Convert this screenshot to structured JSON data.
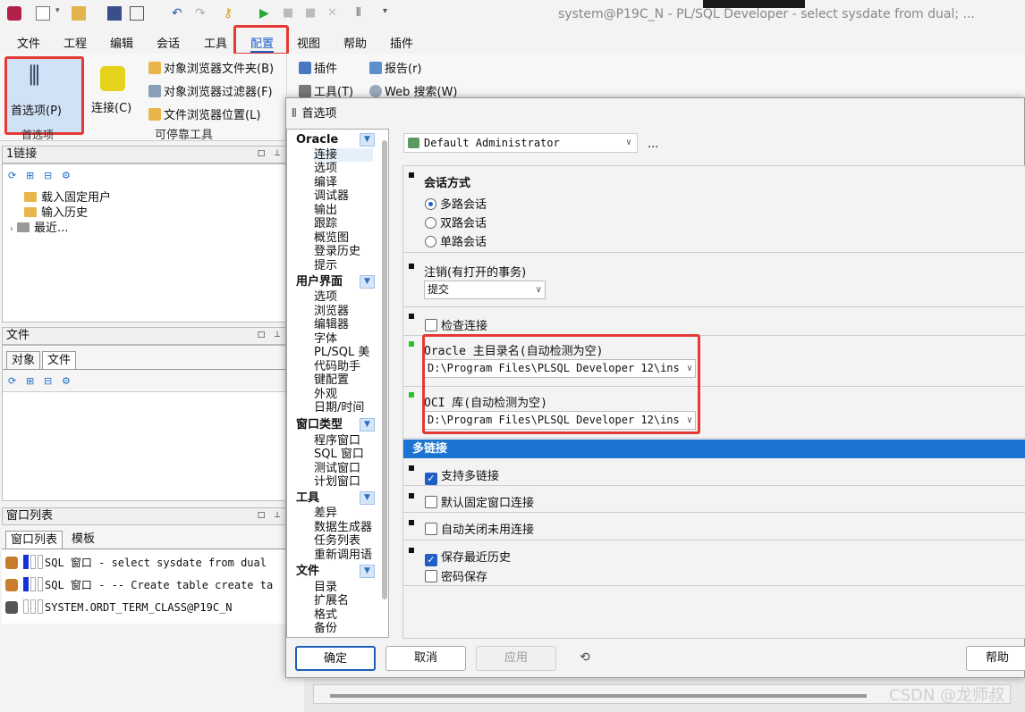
{
  "window": {
    "title": "system@P19C_N - PL/SQL Developer - select sysdate from dual; ..."
  },
  "menu": [
    "文件",
    "工程",
    "编辑",
    "会话",
    "工具",
    "配置",
    "视图",
    "帮助",
    "插件"
  ],
  "ribbon": {
    "preferences_label": "首选项(P)",
    "connect_label": "连接(C)",
    "obj_browser_folder": "对象浏览器文件夹(B)",
    "obj_browser_filter": "对象浏览器过滤器(F)",
    "file_browser_location": "文件浏览器位置(L)",
    "plugins": "插件",
    "tools": "工具(T)",
    "reports": "报告(r)",
    "web_search": "Web 搜索(W)",
    "group_preferences": "首选项",
    "group_dockable": "可停靠工具"
  },
  "connections_panel": {
    "title": "1链接",
    "items": [
      "载入固定用户",
      "输入历史",
      "最近..."
    ]
  },
  "files_panel": {
    "title": "文件",
    "tabs": [
      "对象",
      "文件"
    ]
  },
  "window_list_panel": {
    "title": "窗口列表",
    "tabs": [
      "窗口列表",
      "模板"
    ],
    "rows": [
      "SQL 窗口 - select sysdate from dual",
      "SQL 窗口 - -- Create table create ta",
      "SYSTEM.ORDT_TERM_CLASS@P19C_N"
    ]
  },
  "dialog": {
    "title": "首选项",
    "profile": "Default Administrator",
    "profile_more": "...",
    "nav": {
      "groups": [
        {
          "label": "Oracle",
          "items": [
            "连接",
            "选项",
            "编译",
            "调试器",
            "输出",
            "跟踪",
            "概览图",
            "登录历史",
            "提示"
          ]
        },
        {
          "label": "用户界面",
          "items": [
            "选项",
            "浏览器",
            "编辑器",
            "字体",
            "PL/SQL 美",
            "代码助手",
            "键配置",
            "外观",
            "日期/时间"
          ]
        },
        {
          "label": "窗口类型",
          "items": [
            "程序窗口",
            "SQL 窗口",
            "测试窗口",
            "计划窗口"
          ]
        },
        {
          "label": "工具",
          "items": [
            "差异",
            "数据生成器",
            "任务列表",
            "重新调用语"
          ]
        },
        {
          "label": "文件",
          "items": [
            "目录",
            "扩展名",
            "格式",
            "备份"
          ]
        }
      ]
    },
    "settings": {
      "session_mode_label": "会话方式",
      "session_modes": [
        "多路会话",
        "双路会话",
        "单路会话"
      ],
      "logoff_label": "注销(有打开的事务)",
      "logoff_value": "提交",
      "check_connection": "检查连接",
      "oracle_home_label": "Oracle 主目录名(自动检测为空)",
      "oracle_home_value": "D:\\Program Files\\PLSQL Developer 12\\ins",
      "oci_label": "OCI 库(自动检测为空)",
      "oci_value": "D:\\Program Files\\PLSQL Developer 12\\ins",
      "multi_conn_header": "多链接",
      "support_multi": "支持多链接",
      "default_fixed": "默认固定窗口连接",
      "auto_close": "自动关闭未用连接",
      "save_history": "保存最近历史",
      "save_password": "密码保存"
    },
    "buttons": {
      "ok": "确定",
      "cancel": "取消",
      "apply": "应用",
      "help": "帮助"
    }
  },
  "watermark": "CSDN @龙师叔"
}
